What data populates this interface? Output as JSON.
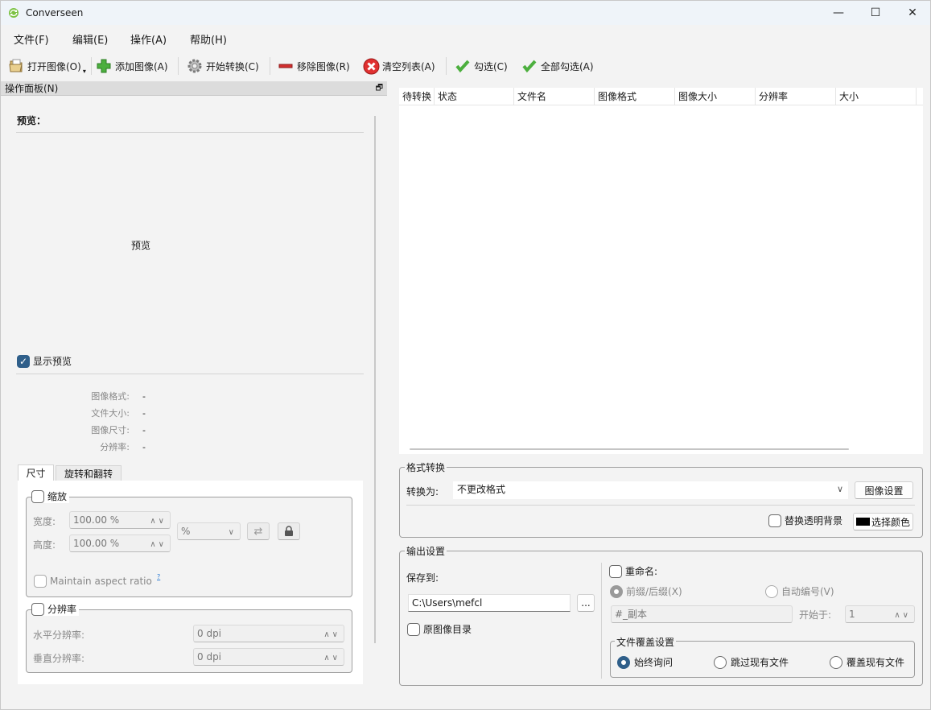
{
  "window": {
    "title": "Converseen",
    "minimize": "—",
    "maximize": "☐",
    "close": "✕"
  },
  "menu": [
    "文件(F)",
    "编辑(E)",
    "操作(A)",
    "帮助(H)"
  ],
  "toolbar": {
    "open": "打开图像(O)",
    "add": "添加图像(A)",
    "convert": "开始转换(C)",
    "remove": "移除图像(R)",
    "clear": "清空列表(A)",
    "check": "勾选(C)",
    "check_all": "全部勾选(A)"
  },
  "panel": {
    "title": "操作面板(N)",
    "preview_label": "预览：",
    "preview_placeholder": "预览",
    "show_preview": "显示预览",
    "info": [
      {
        "label": "图像格式:",
        "value": "-"
      },
      {
        "label": "文件大小:",
        "value": "-"
      },
      {
        "label": "图像尺寸:",
        "value": "-"
      },
      {
        "label": "分辨率:",
        "value": "-"
      }
    ],
    "tabs": [
      "尺寸",
      "旋转和翻转"
    ],
    "scale": {
      "title": "缩放",
      "width_label": "宽度:",
      "width_value": "100.00 %",
      "height_label": "高度:",
      "height_value": "100.00 %",
      "unit": "%",
      "aspect": "Maintain aspect ratio",
      "aspect_mark": "?"
    },
    "resolution": {
      "title": "分辨率",
      "h_label": "水平分辨率:",
      "h_value": "0 dpi",
      "v_label": "垂直分辨率:",
      "v_value": "0 dpi"
    }
  },
  "table": {
    "columns": [
      "待转换",
      "状态",
      "文件名",
      "图像格式",
      "图像大小",
      "分辨率",
      "大小"
    ]
  },
  "format": {
    "title": "格式转换",
    "convert_to_label": "转换为:",
    "convert_to_value": "不更改格式",
    "image_settings": "图像设置",
    "replace_bg": "替换透明背景",
    "choose_color": "选择颜色",
    "color": "#000000"
  },
  "output": {
    "title": "输出设置",
    "save_to": "保存到:",
    "path": "C:\\Users\\mefcl",
    "browse": "...",
    "original_dir": "原图像目录",
    "rename": "重命名:",
    "prefix_suffix": "前缀/后缀(X)",
    "auto_number": "自动编号(V)",
    "pattern": "#_副本",
    "start_at": "开始于:",
    "start_value": "1",
    "overwrite": {
      "title": "文件覆盖设置",
      "always_ask": "始终询问",
      "skip": "跳过现有文件",
      "overwrite": "覆盖现有文件"
    }
  }
}
